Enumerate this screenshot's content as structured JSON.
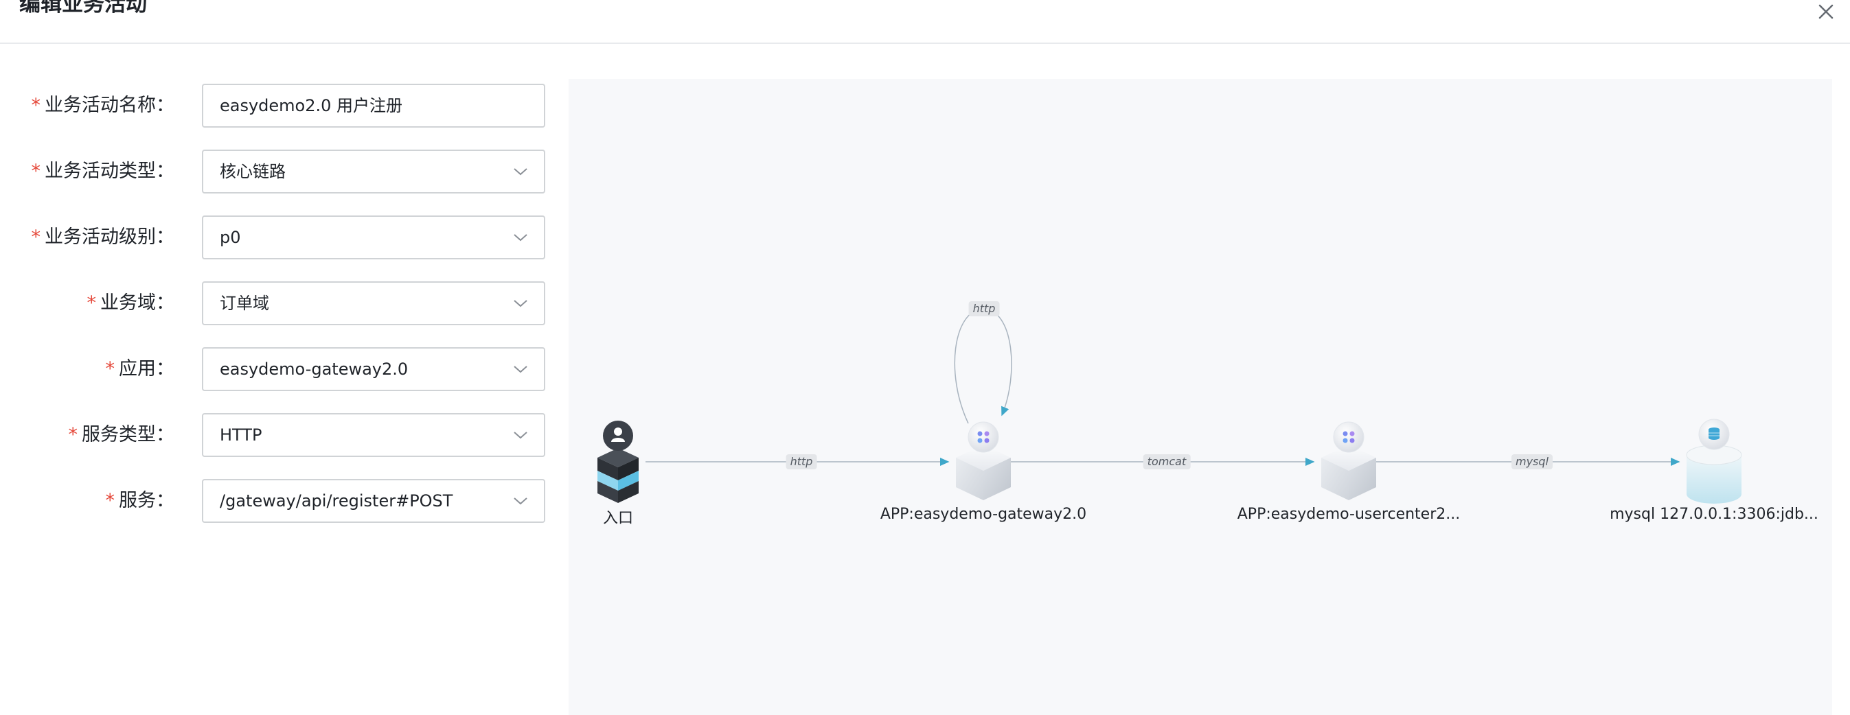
{
  "dialog": {
    "title": "编辑业务活动"
  },
  "form": {
    "activity_name": {
      "label": "业务活动名称：",
      "value": "easydemo2.0 用户注册"
    },
    "activity_type": {
      "label": "业务活动类型：",
      "value": "核心链路"
    },
    "activity_level": {
      "label": "业务活动级别：",
      "value": "p0"
    },
    "business_domain": {
      "label": "业务域：",
      "value": "订单域"
    },
    "application": {
      "label": "应用：",
      "value": "easydemo-gateway2.0"
    },
    "service_type": {
      "label": "服务类型：",
      "value": "HTTP"
    },
    "service": {
      "label": "服务：",
      "value": "/gateway/api/register#POST"
    },
    "required_mark": "*"
  },
  "graph": {
    "nodes": {
      "entry": "入口",
      "gateway": "APP:easydemo-gateway2.0",
      "usercenter": "APP:easydemo-usercenter2...",
      "mysql": "mysql 127.0.0.1:3306:jdb..."
    },
    "edges": {
      "entry_to_gateway": "http",
      "gateway_self": "http",
      "gateway_to_usercenter": "tomcat",
      "usercenter_to_mysql": "mysql"
    }
  },
  "colors": {
    "required": "#e5483a",
    "edge": "#3fa7c9",
    "canvas_bg": "#f7f8fa"
  }
}
